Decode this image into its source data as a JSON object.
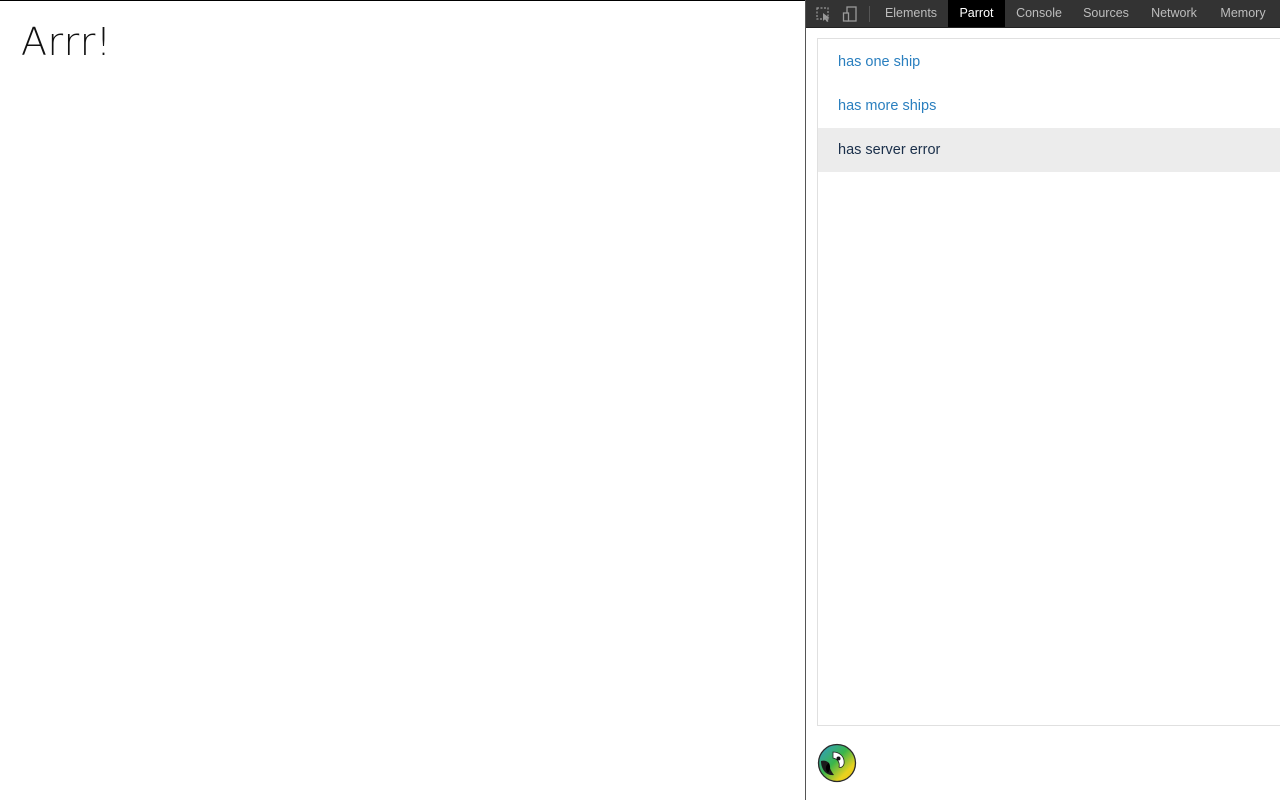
{
  "page": {
    "heading": "Arrr!"
  },
  "devtools": {
    "toolbar": {
      "inspect_icon": "inspect-element-icon",
      "device_icon": "device-toolbar-icon"
    },
    "tabs": [
      {
        "label": "Elements",
        "active": false
      },
      {
        "label": "Parrot",
        "active": true
      },
      {
        "label": "Console",
        "active": false
      },
      {
        "label": "Sources",
        "active": false
      },
      {
        "label": "Network",
        "active": false
      },
      {
        "label": "Memory",
        "active": false
      }
    ],
    "scenarios": [
      {
        "label": "has one ship",
        "selected": false
      },
      {
        "label": "has more ships",
        "selected": false
      },
      {
        "label": "has server error",
        "selected": true
      }
    ],
    "logo_icon": "parrot-logo-icon"
  },
  "colors": {
    "link": "#2a7fbf",
    "selected_text": "#1a2f4a",
    "selected_bg": "#ececec",
    "toolbar_bg": "#333333",
    "active_tab_bg": "#000000"
  }
}
